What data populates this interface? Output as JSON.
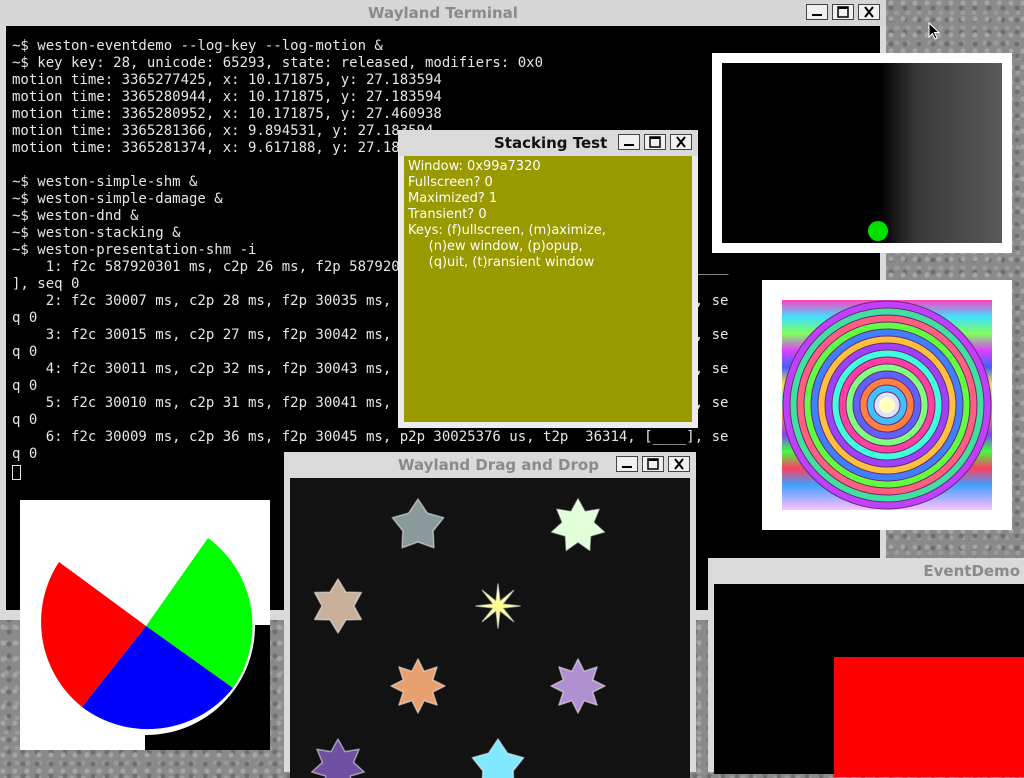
{
  "terminal": {
    "title": "Wayland Terminal",
    "lines": [
      "~$ weston-eventdemo --log-key --log-motion &",
      "~$ key key: 28, unicode: 65293, state: released, modifiers: 0x0",
      "motion time: 3365277425, x: 10.171875, y: 27.183594",
      "motion time: 3365280944, x: 10.171875, y: 27.183594",
      "motion time: 3365280952, x: 10.171875, y: 27.460938",
      "motion time: 3365281366, x: 9.894531, y: 27.183594",
      "motion time: 3365281374, x: 9.617188, y: 27.183594",
      "",
      "~$ weston-simple-shm &",
      "~$ weston-simple-damage &",
      "~$ weston-dnd &",
      "~$ weston-stacking &",
      "~$ weston-presentation-shm -i",
      "    1: f2c 587920301 ms, c2p 26 ms, f2p 587920327 ms, p2p     0 us, t2p  25874, [____",
      "], seq 0",
      "    2: f2c 30007 ms, c2p 28 ms, f2p 30035 ms, p2p 30019371 us, t2p  27367, [____], se",
      "q 0",
      "    3: f2c 30015 ms, c2p 27 ms, f2p 30042 ms, p2p 30018493 us, t2p  26976, [____], se",
      "q 0",
      "    4: f2c 30011 ms, c2p 32 ms, f2p 30043 ms, p2p 30022973 us, t2p  32228, [____], se",
      "q 0",
      "    5: f2c 30010 ms, c2p 31 ms, f2p 30041 ms, p2p 30019859 us, t2p  30841, [____], se",
      "q 0",
      "    6: f2c 30009 ms, c2p 36 ms, f2p 30045 ms, p2p 30025376 us, t2p  36314, [____], se",
      "q 0"
    ]
  },
  "stacking": {
    "title": "Stacking Test",
    "lines": [
      "Window: 0x99a7320",
      "Fullscreen? 0",
      "Maximized? 1",
      "Transient? 0",
      "Keys: (f)ullscreen, (m)aximize,",
      "     (n)ew window, (p)opup,",
      "     (q)uit, (t)ransient window"
    ],
    "bg_color": "#999900"
  },
  "dnd": {
    "title": "Wayland Drag and Drop",
    "items": [
      {
        "name": "flower-gray",
        "color": "#8a9a9a"
      },
      {
        "name": "flower-mint",
        "color": "#e0ffd8"
      },
      {
        "name": "flower-tan",
        "color": "#c8b09a"
      },
      {
        "name": "flower-star-yellow",
        "color": "#ffff88"
      },
      {
        "name": "flower-orange",
        "color": "#e8a070"
      },
      {
        "name": "flower-violet",
        "color": "#b090d0"
      },
      {
        "name": "flower-purple",
        "color": "#7050a0"
      },
      {
        "name": "flower-cyan",
        "color": "#80e8ff"
      }
    ]
  },
  "eventdemo": {
    "title": "EventDemo",
    "rect_color": "#ff0000"
  },
  "simple_shm": {
    "dot_color": "#00e000"
  },
  "pie": {
    "colors": [
      "#ff0000",
      "#00ff00",
      "#0000ff",
      "#ffffff"
    ]
  },
  "icons": {
    "minimize": "minimize-icon",
    "maximize": "maximize-icon",
    "close": "close-icon",
    "pointer": "pointer-icon"
  }
}
